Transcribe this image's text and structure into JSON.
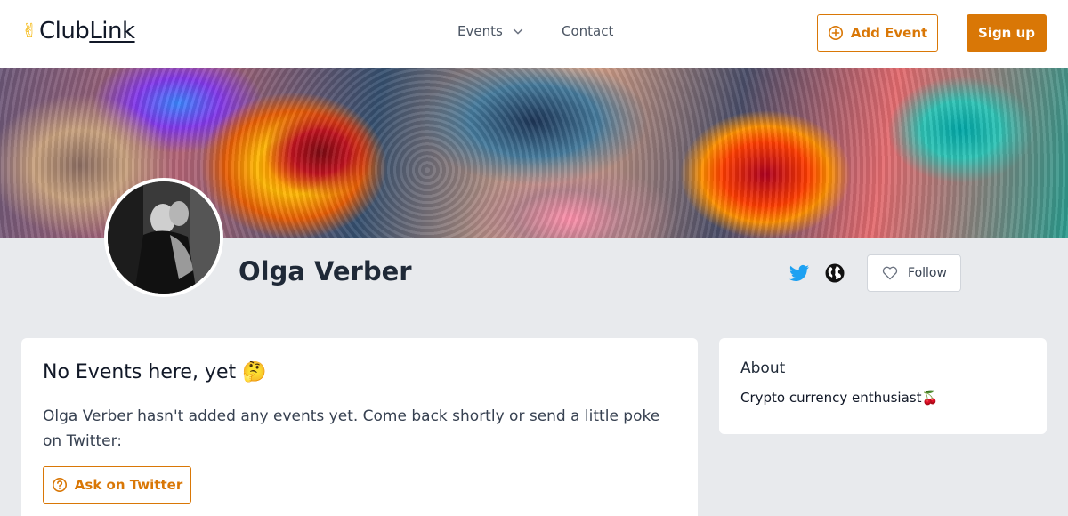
{
  "header": {
    "logo_emoji": "✌",
    "logo_text_club": "Club",
    "logo_text_link": "Link",
    "nav_events": "Events",
    "nav_contact": "Contact",
    "add_event_label": "Add Event",
    "sign_up_label": "Sign up"
  },
  "profile": {
    "name": "Olga Verber",
    "follow_label": "Follow",
    "social_icons": [
      "twitter-icon",
      "globe-icon"
    ]
  },
  "events_card": {
    "heading": "No Events here, yet 🤔",
    "message": "Olga Verber hasn't added any events yet. Come back shortly or send a little poke on Twitter:",
    "ask_label": "Ask on Twitter"
  },
  "about_card": {
    "heading": "About",
    "text": "Crypto currency enthusiast🍒"
  },
  "colors": {
    "accent": "#d97706",
    "page_background": "#e8eaed",
    "twitter": "#1da1f2"
  }
}
